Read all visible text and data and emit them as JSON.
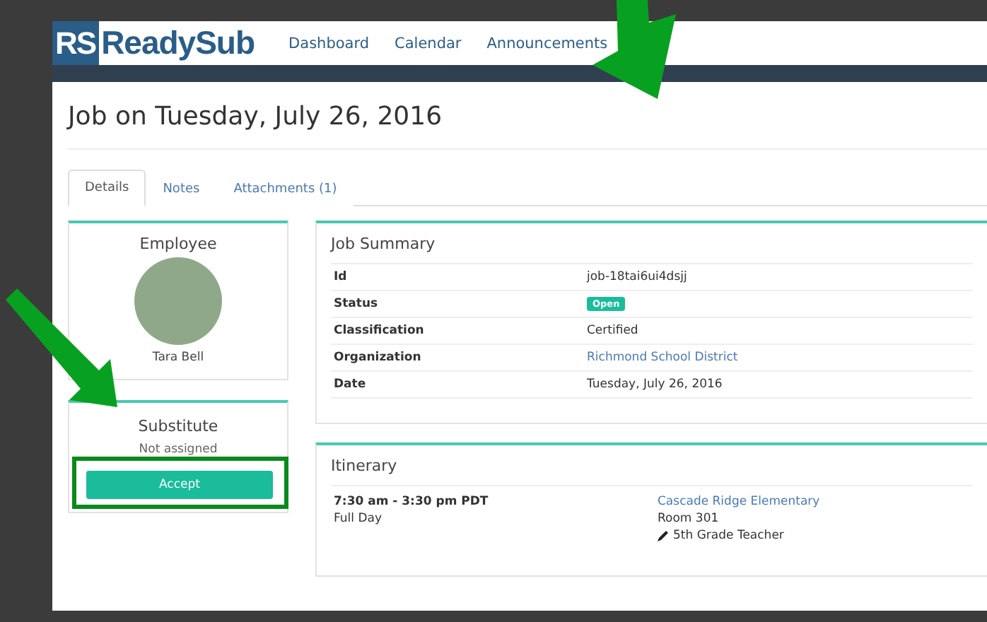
{
  "nav": {
    "logo_badge": "RS",
    "logo_text": "ReadySub",
    "links": [
      "Dashboard",
      "Calendar",
      "Announcements"
    ]
  },
  "page_title": "Job on Tuesday, July 26, 2016",
  "tabs": [
    {
      "label": "Details",
      "selected": true
    },
    {
      "label": "Notes",
      "selected": false
    },
    {
      "label": "Attachments (1)",
      "selected": false
    }
  ],
  "employee": {
    "title": "Employee",
    "name": "Tara Bell"
  },
  "substitute": {
    "title": "Substitute",
    "status": "Not assigned",
    "button": "Accept",
    "highlighted": true
  },
  "job_summary": {
    "title": "Job Summary",
    "rows": [
      {
        "label": "Id",
        "value": "job-18tai6ui4dsjj",
        "kind": "text"
      },
      {
        "label": "Status",
        "value": "Open",
        "kind": "badge"
      },
      {
        "label": "Classification",
        "value": "Certified",
        "kind": "text"
      },
      {
        "label": "Organization",
        "value": "Richmond School District",
        "kind": "link"
      },
      {
        "label": "Date",
        "value": "Tuesday, July 26, 2016",
        "kind": "text"
      }
    ]
  },
  "itinerary": {
    "title": "Itinerary",
    "time": "7:30 am - 3:30 pm PDT",
    "duration": "Full Day",
    "school": "Cascade Ridge Elementary",
    "room": "Room 301",
    "position": "5th Grade Teacher"
  }
}
